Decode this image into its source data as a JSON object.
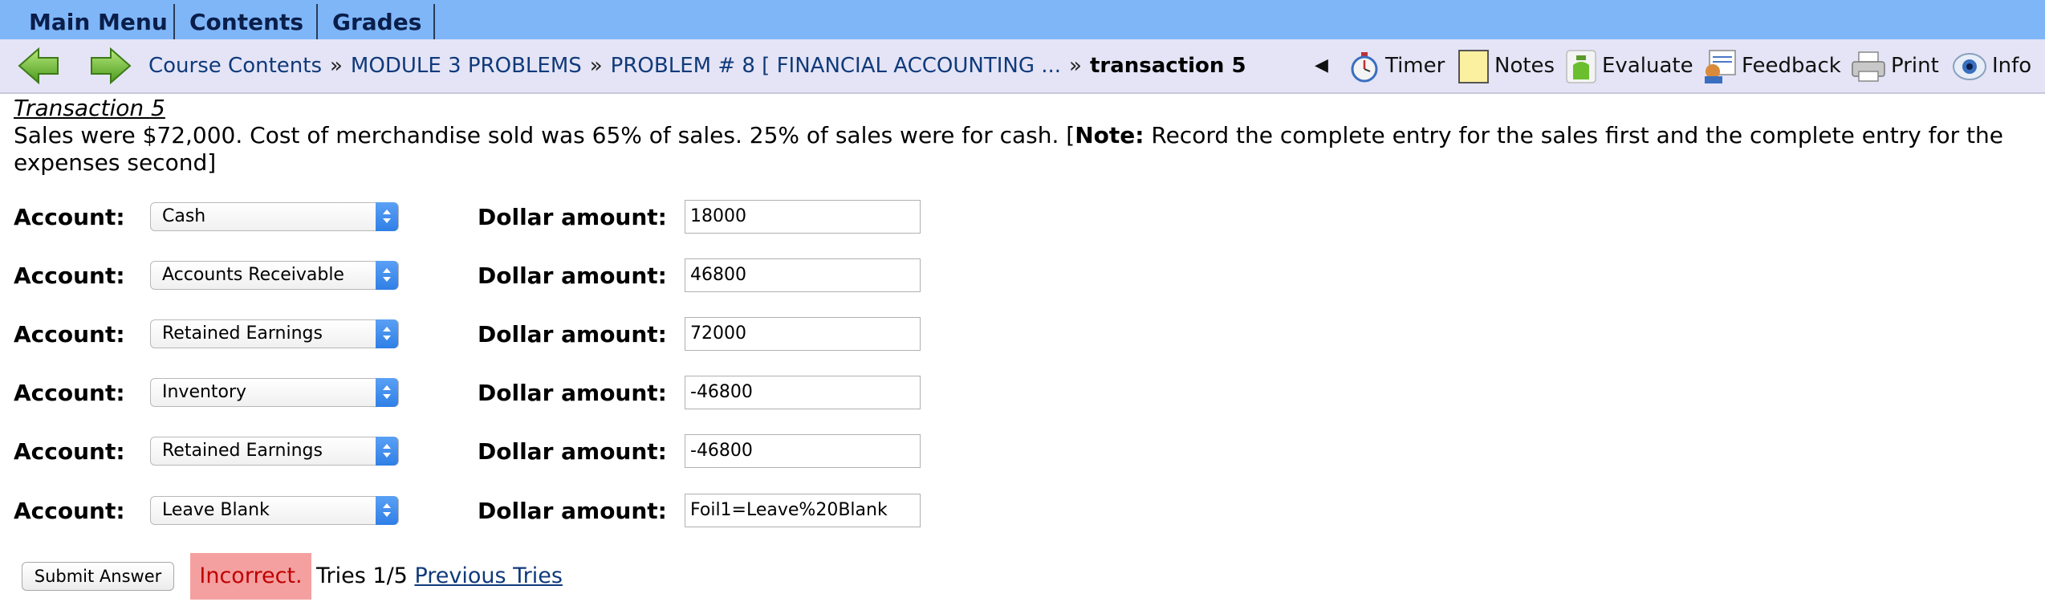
{
  "menu": {
    "tabs": [
      "Main Menu",
      "Contents",
      "Grades"
    ]
  },
  "nav": {
    "back_icon": "green-left-arrow-icon",
    "forward_icon": "green-right-arrow-icon",
    "breadcrumbs": [
      "Course Contents",
      "MODULE 3 PROBLEMS",
      "PROBLEM # 8 [ FINANCIAL ACCOUNTING ..."
    ],
    "separator": "»",
    "current": "transaction 5",
    "collapse_glyph": "◀",
    "tools": [
      {
        "label": "Timer",
        "icon": "stopwatch-icon"
      },
      {
        "label": "Notes",
        "icon": "notepad-icon"
      },
      {
        "label": "Evaluate",
        "icon": "evaluate-icon"
      },
      {
        "label": "Feedback",
        "icon": "feedback-icon"
      },
      {
        "label": "Print",
        "icon": "printer-icon"
      },
      {
        "label": "Info",
        "icon": "info-icon"
      }
    ]
  },
  "content": {
    "title": "Transaction 5",
    "problem_text_1": "Sales were $72,000. Cost of merchandise sold was 65% of sales. 25% of sales were for cash. [",
    "problem_note_bold": "Note:",
    "problem_text_2": " Record the complete entry for the sales first and the complete entry for the expenses second]"
  },
  "entries": {
    "account_label": "Account:",
    "amount_label": "Dollar amount:",
    "rows": [
      {
        "account": "Cash",
        "amount": "18000"
      },
      {
        "account": "Accounts Receivable",
        "amount": "46800"
      },
      {
        "account": "Retained Earnings",
        "amount": "72000"
      },
      {
        "account": "Inventory",
        "amount": "-46800"
      },
      {
        "account": "Retained Earnings",
        "amount": "-46800"
      },
      {
        "account": "Leave Blank",
        "amount": "Foil1=Leave%20Blank"
      }
    ]
  },
  "footer": {
    "submit_label": "Submit Answer",
    "status": "Incorrect.",
    "tries": "Tries 1/5",
    "previous_tries": "Previous Tries"
  },
  "colors": {
    "menubar": "#7fb6f8",
    "navbar": "#e4e4f6",
    "link": "#103a7a",
    "incorrect_bg": "#f5a0a0",
    "incorrect_text": "#c00000"
  }
}
